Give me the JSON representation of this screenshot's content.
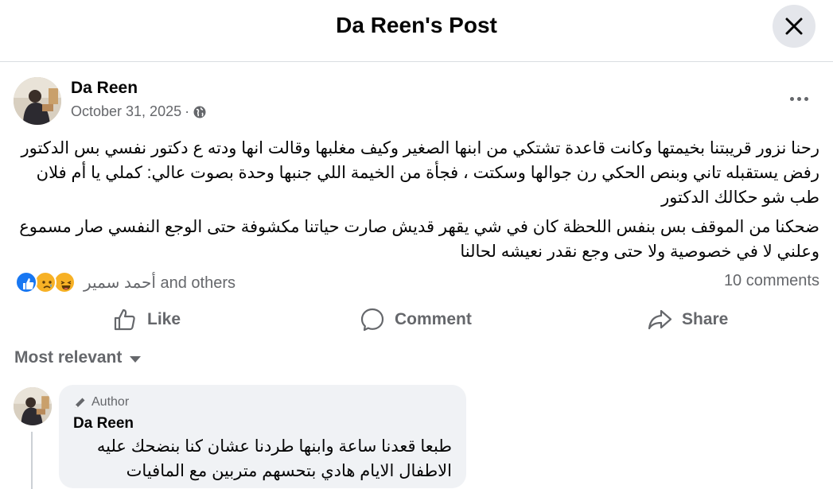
{
  "header": {
    "title": "Da Reen's Post",
    "close_icon": "close-icon"
  },
  "post": {
    "author": "Da Reen",
    "date": "October 31, 2025",
    "separator": "·",
    "privacy_icon": "globe-icon",
    "more_icon": "more-horizontal-icon",
    "paragraphs": [
      "رحنا نزور قريبتنا بخيمتها وكانت قاعدة تشتكي من ابنها الصغير وكيف مغلبها وقالت انها ودته ع دكتور نفسي بس الدكتور رفض يستقبله تاني وبنص الحكي رن جوالها وسكتت ، فجأة من الخيمة اللي جنبها وحدة بصوت عالي: كملي يا أم فلان طب شو حكالك الدكتور",
      "ضحكنا من الموقف بس بنفس اللحظة كان في شي يقهر قديش صارت حياتنا مكشوفة حتى الوجع النفسي صار مسموع وعلني لا في خصوصية ولا حتى وجع نقدر نعيشه لحالنا"
    ]
  },
  "reactions": {
    "icons": [
      "like-reaction-icon",
      "sad-reaction-icon",
      "haha-reaction-icon"
    ],
    "names": "أحمد سمير and others",
    "comments_count": "10 comments"
  },
  "actions": {
    "like": "Like",
    "comment": "Comment",
    "share": "Share"
  },
  "sort": {
    "label": "Most relevant"
  },
  "comment": {
    "badge": "Author",
    "author": "Da Reen",
    "text": "طبعا قعدنا ساعة وابنها طردنا عشان كنا بنضحك عليه الاطفال الايام هادي بتحسهم متربين مع المافيات"
  },
  "colors": {
    "like_blue": "#1877f2",
    "reaction_yellow": "#f7b125",
    "secondary_text": "#65676b",
    "bubble_bg": "#f0f2f5",
    "close_bg": "#e4e6eb"
  }
}
